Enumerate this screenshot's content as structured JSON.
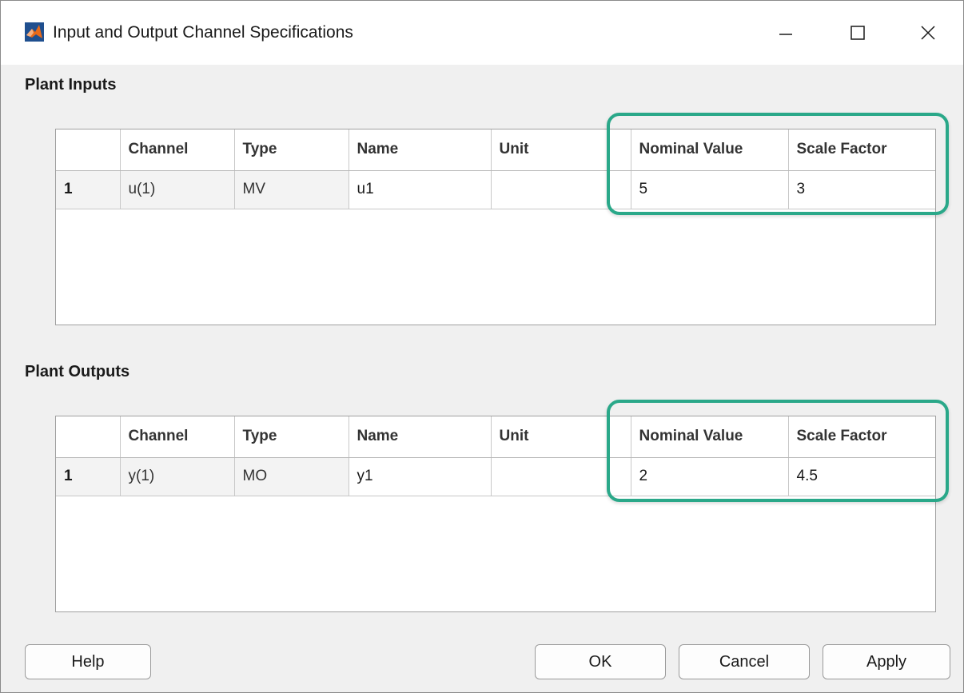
{
  "window": {
    "title": "Input and Output Channel Specifications",
    "icon": "matlab-icon",
    "controls": {
      "minimize": "minimize-icon",
      "maximize": "maximize-icon",
      "close": "close-icon"
    }
  },
  "inputs": {
    "label": "Plant Inputs",
    "columns": [
      "",
      "Channel",
      "Type",
      "Name",
      "Unit",
      "Nominal Value",
      "Scale Factor"
    ],
    "rows": [
      {
        "index": "1",
        "channel": "u(1)",
        "type": "MV",
        "name": "u1",
        "unit": "",
        "nominal": "5",
        "scale": "3"
      }
    ]
  },
  "outputs": {
    "label": "Plant Outputs",
    "columns": [
      "",
      "Channel",
      "Type",
      "Name",
      "Unit",
      "Nominal Value",
      "Scale Factor"
    ],
    "rows": [
      {
        "index": "1",
        "channel": "y(1)",
        "type": "MO",
        "name": "y1",
        "unit": "",
        "nominal": "2",
        "scale": "4.5"
      }
    ]
  },
  "buttons": {
    "help": "Help",
    "ok": "OK",
    "cancel": "Cancel",
    "apply": "Apply"
  },
  "colors": {
    "highlight": "#2aa889",
    "matlab_blue": "#1f4f8f",
    "matlab_orange": "#e86a1a"
  }
}
